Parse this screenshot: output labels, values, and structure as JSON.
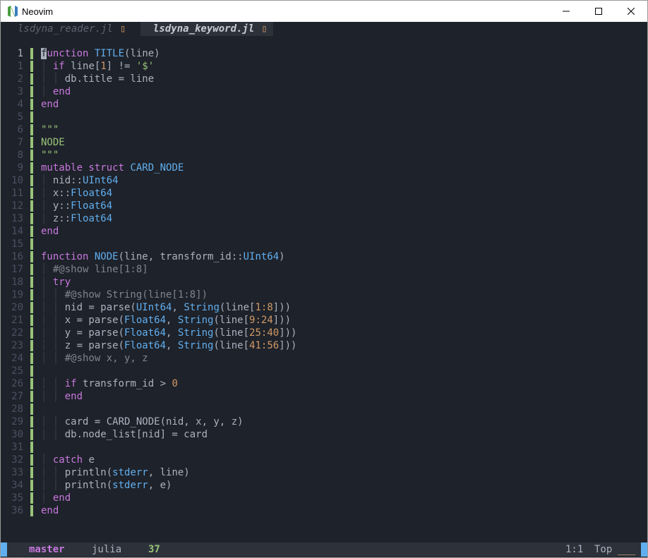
{
  "window": {
    "title": "Neovim"
  },
  "tabs": [
    {
      "label": "lsdyna_reader.jl",
      "marker": "▯",
      "active": false
    },
    {
      "label": "lsdyna_keyword.jl",
      "marker": "▯",
      "active": true
    }
  ],
  "lines": [
    {
      "num": "1",
      "current": true,
      "sign": true,
      "tokens": [
        [
          "cursor",
          "f"
        ],
        [
          "kw",
          "unction "
        ],
        [
          "fn",
          "TITLE"
        ],
        [
          "",
          "(line)"
        ]
      ]
    },
    {
      "num": "1",
      "sign": true,
      "tokens": [
        [
          "guide",
          "│ "
        ],
        [
          "kw",
          "if "
        ],
        [
          "",
          "line["
        ],
        [
          "num",
          "1"
        ],
        [
          "",
          "] != "
        ],
        [
          "str",
          "'$'"
        ]
      ]
    },
    {
      "num": "2",
      "sign": true,
      "tokens": [
        [
          "guide",
          "│ │ "
        ],
        [
          "",
          "db.title = line"
        ]
      ]
    },
    {
      "num": "3",
      "sign": true,
      "tokens": [
        [
          "guide",
          "│ "
        ],
        [
          "kw",
          "end"
        ]
      ]
    },
    {
      "num": "4",
      "sign": true,
      "tokens": [
        [
          "kw",
          "end"
        ]
      ]
    },
    {
      "num": "5",
      "sign": true,
      "tokens": []
    },
    {
      "num": "6",
      "sign": true,
      "tokens": [
        [
          "str",
          "\"\"\""
        ]
      ]
    },
    {
      "num": "7",
      "sign": true,
      "tokens": [
        [
          "str",
          "NODE"
        ]
      ]
    },
    {
      "num": "8",
      "sign": true,
      "tokens": [
        [
          "str",
          "\"\"\""
        ]
      ]
    },
    {
      "num": "9",
      "sign": true,
      "tokens": [
        [
          "kw",
          "mutable struct "
        ],
        [
          "ty",
          "CARD_NODE"
        ]
      ]
    },
    {
      "num": "10",
      "sign": true,
      "tokens": [
        [
          "guide",
          "│ "
        ],
        [
          "",
          "nid::"
        ],
        [
          "ty",
          "UInt64"
        ]
      ]
    },
    {
      "num": "11",
      "sign": true,
      "tokens": [
        [
          "guide",
          "│ "
        ],
        [
          "",
          "x::"
        ],
        [
          "ty",
          "Float64"
        ]
      ]
    },
    {
      "num": "12",
      "sign": true,
      "tokens": [
        [
          "guide",
          "│ "
        ],
        [
          "",
          "y::"
        ],
        [
          "ty",
          "Float64"
        ]
      ]
    },
    {
      "num": "13",
      "sign": true,
      "tokens": [
        [
          "guide",
          "│ "
        ],
        [
          "",
          "z::"
        ],
        [
          "ty",
          "Float64"
        ]
      ]
    },
    {
      "num": "14",
      "sign": true,
      "tokens": [
        [
          "kw",
          "end"
        ]
      ]
    },
    {
      "num": "15",
      "sign": true,
      "tokens": []
    },
    {
      "num": "16",
      "sign": true,
      "tokens": [
        [
          "kw",
          "function "
        ],
        [
          "fn",
          "NODE"
        ],
        [
          "",
          "(line, transform_id::"
        ],
        [
          "ty",
          "UInt64"
        ],
        [
          "",
          ")"
        ]
      ]
    },
    {
      "num": "17",
      "sign": true,
      "tokens": [
        [
          "guide",
          "│ "
        ],
        [
          "cm",
          "#@show line[1:8]"
        ]
      ]
    },
    {
      "num": "18",
      "sign": true,
      "tokens": [
        [
          "guide",
          "│ "
        ],
        [
          "kw",
          "try"
        ]
      ]
    },
    {
      "num": "19",
      "sign": true,
      "tokens": [
        [
          "guide",
          "│ │ "
        ],
        [
          "cm",
          "#@show String(line[1:8])"
        ]
      ]
    },
    {
      "num": "20",
      "sign": true,
      "tokens": [
        [
          "guide",
          "│ │ "
        ],
        [
          "",
          "nid = parse("
        ],
        [
          "ty",
          "UInt64"
        ],
        [
          "",
          ", "
        ],
        [
          "ty",
          "String"
        ],
        [
          "",
          "(line["
        ],
        [
          "num",
          "1:8"
        ],
        [
          "",
          "]))"
        ]
      ]
    },
    {
      "num": "21",
      "sign": true,
      "tokens": [
        [
          "guide",
          "│ │ "
        ],
        [
          "",
          "x = parse("
        ],
        [
          "ty",
          "Float64"
        ],
        [
          "",
          ", "
        ],
        [
          "ty",
          "String"
        ],
        [
          "",
          "(line["
        ],
        [
          "num",
          "9:24"
        ],
        [
          "",
          "]))"
        ]
      ]
    },
    {
      "num": "22",
      "sign": true,
      "tokens": [
        [
          "guide",
          "│ │ "
        ],
        [
          "",
          "y = parse("
        ],
        [
          "ty",
          "Float64"
        ],
        [
          "",
          ", "
        ],
        [
          "ty",
          "String"
        ],
        [
          "",
          "(line["
        ],
        [
          "num",
          "25:40"
        ],
        [
          "",
          "]))"
        ]
      ]
    },
    {
      "num": "23",
      "sign": true,
      "tokens": [
        [
          "guide",
          "│ │ "
        ],
        [
          "",
          "z = parse("
        ],
        [
          "ty",
          "Float64"
        ],
        [
          "",
          ", "
        ],
        [
          "ty",
          "String"
        ],
        [
          "",
          "(line["
        ],
        [
          "num",
          "41:56"
        ],
        [
          "",
          "]))"
        ]
      ]
    },
    {
      "num": "24",
      "sign": true,
      "tokens": [
        [
          "guide",
          "│ │ "
        ],
        [
          "cm",
          "#@show x, y, z"
        ]
      ]
    },
    {
      "num": "25",
      "sign": true,
      "tokens": []
    },
    {
      "num": "26",
      "sign": true,
      "tokens": [
        [
          "guide",
          "│ │ "
        ],
        [
          "kw",
          "if "
        ],
        [
          "",
          "transform_id > "
        ],
        [
          "num",
          "0"
        ]
      ]
    },
    {
      "num": "27",
      "sign": true,
      "tokens": [
        [
          "guide",
          "│ │ "
        ],
        [
          "kw",
          "end"
        ]
      ]
    },
    {
      "num": "28",
      "sign": true,
      "tokens": []
    },
    {
      "num": "29",
      "sign": true,
      "tokens": [
        [
          "guide",
          "│ │ "
        ],
        [
          "",
          "card = CARD_NODE(nid, x, y, z)"
        ]
      ]
    },
    {
      "num": "30",
      "sign": true,
      "tokens": [
        [
          "guide",
          "│ │ "
        ],
        [
          "",
          "db.node_list[nid] = card"
        ]
      ]
    },
    {
      "num": "31",
      "sign": true,
      "tokens": []
    },
    {
      "num": "32",
      "sign": true,
      "tokens": [
        [
          "guide",
          "│ "
        ],
        [
          "kw",
          "catch "
        ],
        [
          "",
          "e"
        ]
      ]
    },
    {
      "num": "33",
      "sign": true,
      "tokens": [
        [
          "guide",
          "│ │ "
        ],
        [
          "",
          "println("
        ],
        [
          "ty",
          "stderr"
        ],
        [
          "",
          ", line)"
        ]
      ]
    },
    {
      "num": "34",
      "sign": true,
      "tokens": [
        [
          "guide",
          "│ │ "
        ],
        [
          "",
          "println("
        ],
        [
          "ty",
          "stderr"
        ],
        [
          "",
          ", e)"
        ]
      ]
    },
    {
      "num": "35",
      "sign": true,
      "tokens": [
        [
          "guide",
          "│ "
        ],
        [
          "kw",
          "end"
        ]
      ]
    },
    {
      "num": "36",
      "sign": true,
      "tokens": [
        [
          "kw",
          "end"
        ]
      ]
    }
  ],
  "statusline": {
    "branch": "master",
    "filetype": "julia",
    "line_count": "37",
    "position": "1:1",
    "scroll": "Top",
    "bar": "___"
  }
}
